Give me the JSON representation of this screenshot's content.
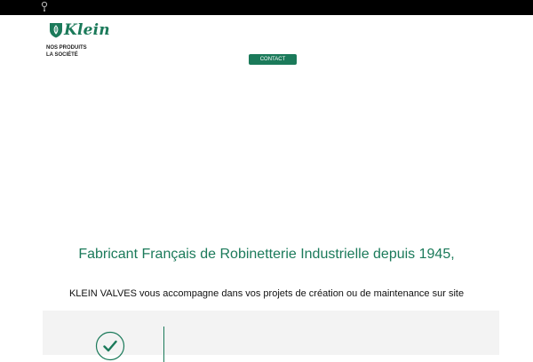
{
  "header": {
    "logo_text": "Klein",
    "lang_icon": "globe-pin-icon",
    "logo_icon": "shield-leaf-icon"
  },
  "nav": {
    "items": [
      {
        "label": "NOS PRODUITS"
      },
      {
        "label": "LA SOCIÉTÉ"
      }
    ],
    "contact_label": "CONTACT"
  },
  "hero": {
    "title": "Fabricant Français de Robinetterie Industrielle depuis 1945,",
    "subtitle": "KLEIN VALVES vous accompagne dans vos projets de création ou de maintenance sur site"
  },
  "features": {
    "icon": "check-circle-icon"
  },
  "colors": {
    "brand": "#1b7a5a",
    "topbar": "#000000",
    "panel": "#f3f3f3"
  }
}
